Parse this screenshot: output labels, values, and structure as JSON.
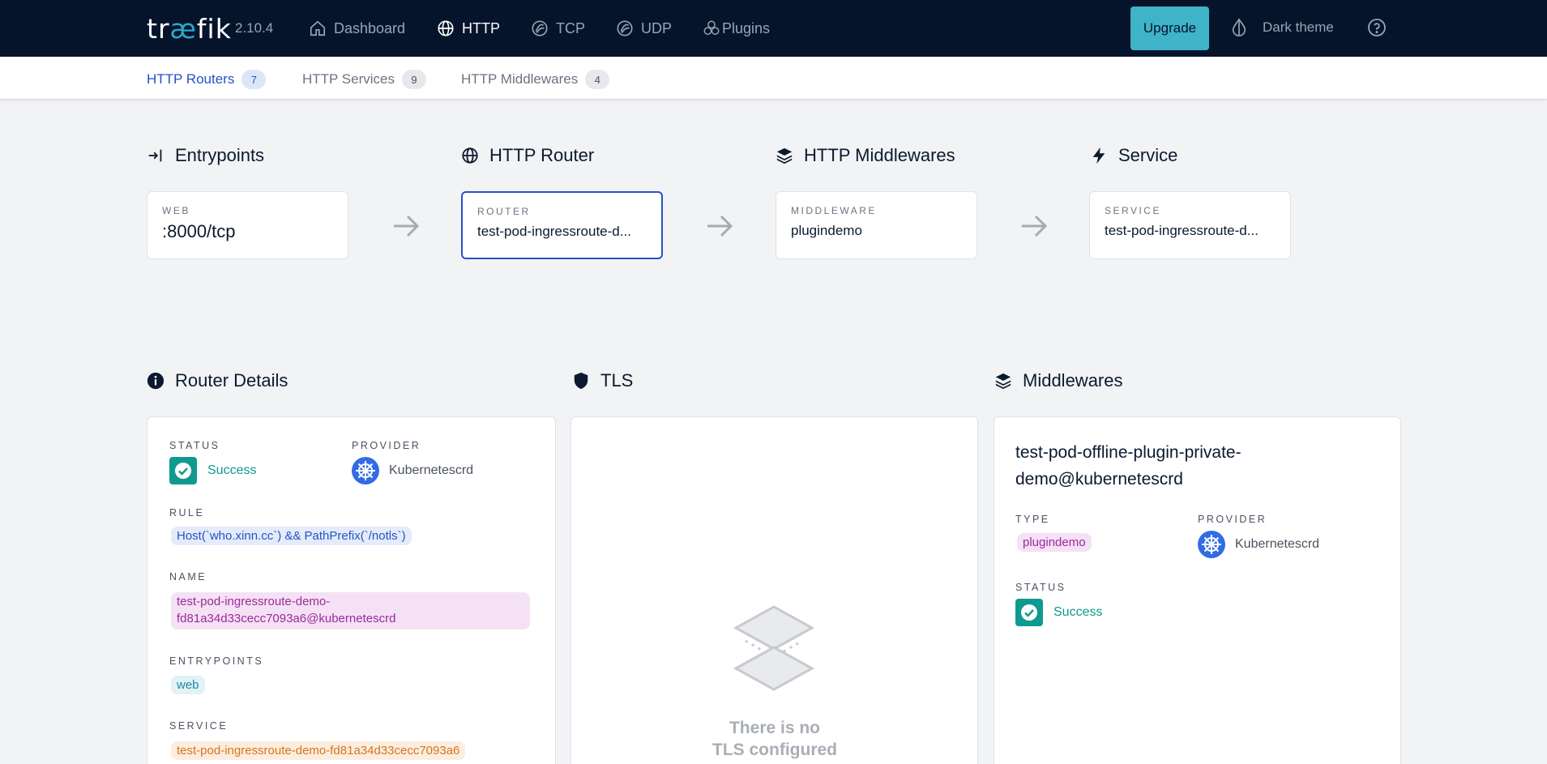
{
  "navbar": {
    "brand_pre": "tr",
    "brand_ae": "æ",
    "brand_post": "fik",
    "version": "2.10.4",
    "items": [
      {
        "label": "Dashboard",
        "icon": "home-icon"
      },
      {
        "label": "HTTP",
        "icon": "globe-icon"
      },
      {
        "label": "TCP",
        "icon": "tcp-icon"
      },
      {
        "label": "UDP",
        "icon": "udp-icon"
      },
      {
        "label": "Plugins",
        "icon": "plugins-icon"
      }
    ],
    "upgrade_label": "Upgrade",
    "theme_label": "Dark theme",
    "help_icon": "help-icon"
  },
  "subtabs": [
    {
      "label": "HTTP Routers",
      "count": "7"
    },
    {
      "label": "HTTP Services",
      "count": "9"
    },
    {
      "label": "HTTP Middlewares",
      "count": "4"
    }
  ],
  "flow": {
    "entrypoints": {
      "title": "Entrypoints",
      "label": "WEB",
      "value": ":8000/tcp"
    },
    "router": {
      "title": "HTTP Router",
      "label": "ROUTER",
      "value": "test-pod-ingressroute-d..."
    },
    "middlewares": {
      "title": "HTTP Middlewares",
      "label": "MIDDLEWARE",
      "value": "plugindemo"
    },
    "service": {
      "title": "Service",
      "label": "SERVICE",
      "value": "test-pod-ingressroute-d..."
    }
  },
  "router_details": {
    "title": "Router Details",
    "status_label": "STATUS",
    "status_value": "Success",
    "provider_label": "PROVIDER",
    "provider_value": "Kubernetescrd",
    "rule_label": "RULE",
    "rule_value": "Host(`who.xinn.cc`) && PathPrefix(`/notls`)",
    "name_label": "NAME",
    "name_line1": "test-pod-ingressroute-demo-",
    "name_line2": "fd81a34d33cecc7093a6@kubernetescrd",
    "entrypoints_label": "ENTRYPOINTS",
    "entrypoints_value": "web",
    "service_label": "SERVICE",
    "service_value": "test-pod-ingressroute-demo-fd81a34d33cecc7093a6"
  },
  "tls": {
    "title": "TLS",
    "empty_line1": "There is no",
    "empty_line2": "TLS configured"
  },
  "middlewares": {
    "title": "Middlewares",
    "name_line1": "test-pod-offline-plugin-private-",
    "name_line2": "demo@kubernetescrd",
    "type_label": "TYPE",
    "type_value": "plugindemo",
    "provider_label": "PROVIDER",
    "provider_value": "Kubernetescrd",
    "status_label": "STATUS",
    "status_value": "Success"
  },
  "colors": {
    "navbar_bg": "#06142b",
    "accent_blue": "#2353c4",
    "success_green": "#109a8f",
    "upgrade_bg": "#3fb3c8"
  }
}
